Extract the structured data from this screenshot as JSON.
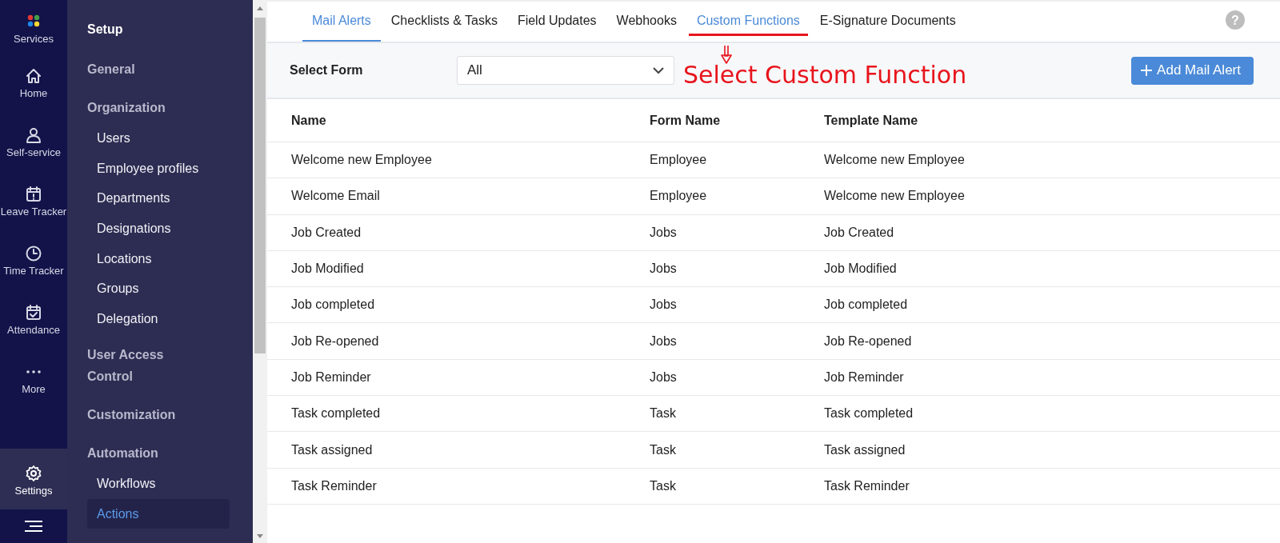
{
  "rail": [
    {
      "kind": "services",
      "label": "Services",
      "selected": false
    },
    {
      "kind": "home",
      "label": "Home",
      "selected": false
    },
    {
      "kind": "person",
      "label": "Self-service",
      "selected": false
    },
    {
      "kind": "calendar-alert",
      "label": "Leave Tracker",
      "selected": false
    },
    {
      "kind": "clock",
      "label": "Time Tracker",
      "selected": false
    },
    {
      "kind": "calendar-check",
      "label": "Attendance",
      "selected": false
    },
    {
      "kind": "more",
      "label": "More",
      "selected": false
    },
    {
      "kind": "gear",
      "label": "Settings",
      "selected": true
    }
  ],
  "sidebar": {
    "title": "Setup",
    "sections": [
      {
        "label": "General"
      },
      {
        "label": "Organization",
        "children": [
          {
            "label": "Users",
            "selected": false
          },
          {
            "label": "Employee profiles",
            "selected": false
          },
          {
            "label": "Departments",
            "selected": false
          },
          {
            "label": "Designations",
            "selected": false
          },
          {
            "label": "Locations",
            "selected": false
          },
          {
            "label": "Groups",
            "selected": false
          },
          {
            "label": "Delegation",
            "selected": false
          }
        ]
      },
      {
        "label": "User Access Control"
      },
      {
        "label": "Customization"
      },
      {
        "label": "Automation",
        "children": [
          {
            "label": "Workflows",
            "selected": false
          },
          {
            "label": "Actions",
            "selected": true
          }
        ]
      }
    ]
  },
  "tabs": [
    {
      "label": "Mail Alerts",
      "selected": true,
      "annotated": false
    },
    {
      "label": "Checklists & Tasks",
      "selected": false,
      "annotated": false
    },
    {
      "label": "Field Updates",
      "selected": false,
      "annotated": false
    },
    {
      "label": "Webhooks",
      "selected": false,
      "annotated": false
    },
    {
      "label": "Custom Functions",
      "selected": false,
      "annotated": true
    },
    {
      "label": "E-Signature Documents",
      "selected": false,
      "annotated": false
    }
  ],
  "help": "?",
  "annotation": {
    "text": "Select Custom Function"
  },
  "filter": {
    "label": "Select Form",
    "value": "All"
  },
  "add_button": "Add Mail Alert",
  "table": {
    "columns": [
      "Name",
      "Form Name",
      "Template Name"
    ],
    "rows": [
      [
        "Welcome new Employee",
        "Employee",
        "Welcome new Employee"
      ],
      [
        "Welcome Email",
        "Employee",
        "Welcome new Employee"
      ],
      [
        "Job Created",
        "Jobs",
        "Job Created"
      ],
      [
        "Job Modified",
        "Jobs",
        "Job Modified"
      ],
      [
        "Job completed",
        "Jobs",
        "Job completed"
      ],
      [
        "Job Re-opened",
        "Jobs",
        "Job Re-opened"
      ],
      [
        "Job Reminder",
        "Jobs",
        "Job Reminder"
      ],
      [
        "Task completed",
        "Task",
        "Task completed"
      ],
      [
        "Task assigned",
        "Task",
        "Task assigned"
      ],
      [
        "Task Reminder",
        "Task",
        "Task Reminder"
      ]
    ]
  }
}
